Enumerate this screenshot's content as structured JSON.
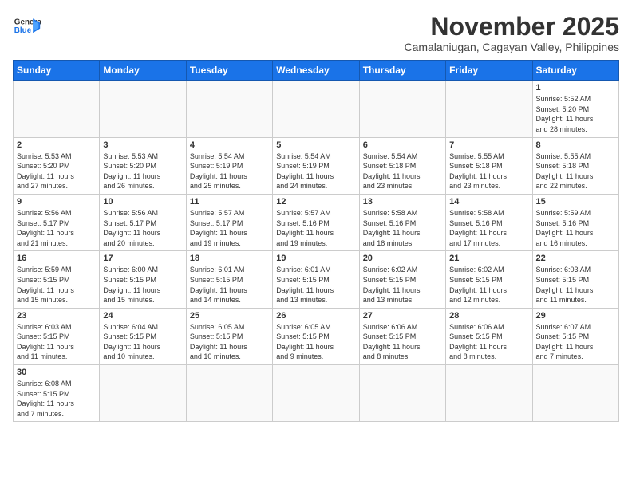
{
  "header": {
    "logo_line1": "General",
    "logo_line2": "Blue",
    "month": "November 2025",
    "location": "Camalaniugan, Cagayan Valley, Philippines"
  },
  "weekdays": [
    "Sunday",
    "Monday",
    "Tuesday",
    "Wednesday",
    "Thursday",
    "Friday",
    "Saturday"
  ],
  "weeks": [
    [
      {
        "day": "",
        "info": ""
      },
      {
        "day": "",
        "info": ""
      },
      {
        "day": "",
        "info": ""
      },
      {
        "day": "",
        "info": ""
      },
      {
        "day": "",
        "info": ""
      },
      {
        "day": "",
        "info": ""
      },
      {
        "day": "1",
        "info": "Sunrise: 5:52 AM\nSunset: 5:20 PM\nDaylight: 11 hours\nand 28 minutes."
      }
    ],
    [
      {
        "day": "2",
        "info": "Sunrise: 5:53 AM\nSunset: 5:20 PM\nDaylight: 11 hours\nand 27 minutes."
      },
      {
        "day": "3",
        "info": "Sunrise: 5:53 AM\nSunset: 5:20 PM\nDaylight: 11 hours\nand 26 minutes."
      },
      {
        "day": "4",
        "info": "Sunrise: 5:54 AM\nSunset: 5:19 PM\nDaylight: 11 hours\nand 25 minutes."
      },
      {
        "day": "5",
        "info": "Sunrise: 5:54 AM\nSunset: 5:19 PM\nDaylight: 11 hours\nand 24 minutes."
      },
      {
        "day": "6",
        "info": "Sunrise: 5:54 AM\nSunset: 5:18 PM\nDaylight: 11 hours\nand 23 minutes."
      },
      {
        "day": "7",
        "info": "Sunrise: 5:55 AM\nSunset: 5:18 PM\nDaylight: 11 hours\nand 23 minutes."
      },
      {
        "day": "8",
        "info": "Sunrise: 5:55 AM\nSunset: 5:18 PM\nDaylight: 11 hours\nand 22 minutes."
      }
    ],
    [
      {
        "day": "9",
        "info": "Sunrise: 5:56 AM\nSunset: 5:17 PM\nDaylight: 11 hours\nand 21 minutes."
      },
      {
        "day": "10",
        "info": "Sunrise: 5:56 AM\nSunset: 5:17 PM\nDaylight: 11 hours\nand 20 minutes."
      },
      {
        "day": "11",
        "info": "Sunrise: 5:57 AM\nSunset: 5:17 PM\nDaylight: 11 hours\nand 19 minutes."
      },
      {
        "day": "12",
        "info": "Sunrise: 5:57 AM\nSunset: 5:16 PM\nDaylight: 11 hours\nand 19 minutes."
      },
      {
        "day": "13",
        "info": "Sunrise: 5:58 AM\nSunset: 5:16 PM\nDaylight: 11 hours\nand 18 minutes."
      },
      {
        "day": "14",
        "info": "Sunrise: 5:58 AM\nSunset: 5:16 PM\nDaylight: 11 hours\nand 17 minutes."
      },
      {
        "day": "15",
        "info": "Sunrise: 5:59 AM\nSunset: 5:16 PM\nDaylight: 11 hours\nand 16 minutes."
      }
    ],
    [
      {
        "day": "16",
        "info": "Sunrise: 5:59 AM\nSunset: 5:15 PM\nDaylight: 11 hours\nand 15 minutes."
      },
      {
        "day": "17",
        "info": "Sunrise: 6:00 AM\nSunset: 5:15 PM\nDaylight: 11 hours\nand 15 minutes."
      },
      {
        "day": "18",
        "info": "Sunrise: 6:01 AM\nSunset: 5:15 PM\nDaylight: 11 hours\nand 14 minutes."
      },
      {
        "day": "19",
        "info": "Sunrise: 6:01 AM\nSunset: 5:15 PM\nDaylight: 11 hours\nand 13 minutes."
      },
      {
        "day": "20",
        "info": "Sunrise: 6:02 AM\nSunset: 5:15 PM\nDaylight: 11 hours\nand 13 minutes."
      },
      {
        "day": "21",
        "info": "Sunrise: 6:02 AM\nSunset: 5:15 PM\nDaylight: 11 hours\nand 12 minutes."
      },
      {
        "day": "22",
        "info": "Sunrise: 6:03 AM\nSunset: 5:15 PM\nDaylight: 11 hours\nand 11 minutes."
      }
    ],
    [
      {
        "day": "23",
        "info": "Sunrise: 6:03 AM\nSunset: 5:15 PM\nDaylight: 11 hours\nand 11 minutes."
      },
      {
        "day": "24",
        "info": "Sunrise: 6:04 AM\nSunset: 5:15 PM\nDaylight: 11 hours\nand 10 minutes."
      },
      {
        "day": "25",
        "info": "Sunrise: 6:05 AM\nSunset: 5:15 PM\nDaylight: 11 hours\nand 10 minutes."
      },
      {
        "day": "26",
        "info": "Sunrise: 6:05 AM\nSunset: 5:15 PM\nDaylight: 11 hours\nand 9 minutes."
      },
      {
        "day": "27",
        "info": "Sunrise: 6:06 AM\nSunset: 5:15 PM\nDaylight: 11 hours\nand 8 minutes."
      },
      {
        "day": "28",
        "info": "Sunrise: 6:06 AM\nSunset: 5:15 PM\nDaylight: 11 hours\nand 8 minutes."
      },
      {
        "day": "29",
        "info": "Sunrise: 6:07 AM\nSunset: 5:15 PM\nDaylight: 11 hours\nand 7 minutes."
      }
    ],
    [
      {
        "day": "30",
        "info": "Sunrise: 6:08 AM\nSunset: 5:15 PM\nDaylight: 11 hours\nand 7 minutes."
      },
      {
        "day": "",
        "info": ""
      },
      {
        "day": "",
        "info": ""
      },
      {
        "day": "",
        "info": ""
      },
      {
        "day": "",
        "info": ""
      },
      {
        "day": "",
        "info": ""
      },
      {
        "day": "",
        "info": ""
      }
    ]
  ]
}
